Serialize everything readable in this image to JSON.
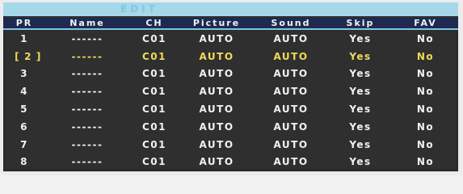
{
  "menu": {
    "title": "EDIT",
    "columns": [
      "PR",
      "Name",
      "CH",
      "Picture",
      "Sound",
      "Skip",
      "FAV"
    ],
    "selected_index": 1,
    "selection_brackets": {
      "left": "[",
      "right": "]"
    },
    "rows": [
      {
        "pr": "1",
        "name": "------",
        "ch": "C01",
        "picture": "AUTO",
        "sound": "AUTO",
        "skip": "Yes",
        "fav": "No"
      },
      {
        "pr": "2",
        "name": "------",
        "ch": "C01",
        "picture": "AUTO",
        "sound": "AUTO",
        "skip": "Yes",
        "fav": "No"
      },
      {
        "pr": "3",
        "name": "------",
        "ch": "C01",
        "picture": "AUTO",
        "sound": "AUTO",
        "skip": "Yes",
        "fav": "No"
      },
      {
        "pr": "4",
        "name": "------",
        "ch": "C01",
        "picture": "AUTO",
        "sound": "AUTO",
        "skip": "Yes",
        "fav": "No"
      },
      {
        "pr": "5",
        "name": "------",
        "ch": "C01",
        "picture": "AUTO",
        "sound": "AUTO",
        "skip": "Yes",
        "fav": "No"
      },
      {
        "pr": "6",
        "name": "------",
        "ch": "C01",
        "picture": "AUTO",
        "sound": "AUTO",
        "skip": "Yes",
        "fav": "No"
      },
      {
        "pr": "7",
        "name": "------",
        "ch": "C01",
        "picture": "AUTO",
        "sound": "AUTO",
        "skip": "Yes",
        "fav": "No"
      },
      {
        "pr": "8",
        "name": "------",
        "ch": "C01",
        "picture": "AUTO",
        "sound": "AUTO",
        "skip": "Yes",
        "fav": "No"
      }
    ]
  },
  "colors": {
    "title_bar": "#a6d8ea",
    "header_bg": "#1f2a52",
    "panel_bg": "#2f2f2f",
    "text": "#f1f1f1",
    "highlight": "#f0da5a"
  }
}
